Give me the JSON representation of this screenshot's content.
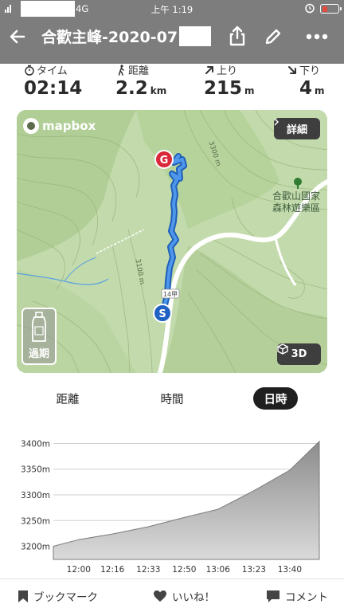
{
  "status": {
    "network": "4G",
    "time": "上午 1:19"
  },
  "header": {
    "title": "合歡主峰-2020-07"
  },
  "stats": [
    {
      "label": "タイム",
      "icon": "stopwatch-icon",
      "value": "02:14",
      "unit": ""
    },
    {
      "label": "距離",
      "icon": "hiker-icon",
      "value": "2.2",
      "unit": "km"
    },
    {
      "label": "上り",
      "icon": "arrow-up-right-icon",
      "value": "215",
      "unit": "m"
    },
    {
      "label": "下り",
      "icon": "arrow-down-right-icon",
      "value": "4",
      "unit": "m"
    }
  ],
  "map": {
    "logo": "mapbox",
    "detail_button": "詳細",
    "three_d_button": "3D",
    "expired_badge": "過期",
    "poi_label": "合歡山國家森林遊樂區",
    "contour_labels": [
      "3300 m",
      "3100 m"
    ],
    "road_label": "14甲",
    "start_marker": "S",
    "goal_marker": "G",
    "colors": {
      "route": "#2f7bd9",
      "goal": "#d9283a",
      "start": "#1f62c4",
      "terrain": "#bfd8a8"
    }
  },
  "toggle": {
    "options": [
      "距離",
      "時間",
      "日時"
    ],
    "selected": "日時"
  },
  "chart_data": {
    "type": "area",
    "x": [
      "11:48",
      "12:00",
      "12:16",
      "12:33",
      "12:50",
      "13:06",
      "13:23",
      "13:40",
      "13:54"
    ],
    "series": [
      {
        "values": [
          3200,
          3213,
          3224,
          3238,
          3256,
          3272,
          3308,
          3348,
          3404
        ]
      }
    ],
    "xticks": [
      "12:00",
      "12:16",
      "12:33",
      "12:50",
      "13:06",
      "13:23",
      "13:40"
    ],
    "yticks": [
      "3400m",
      "3350m",
      "3300m",
      "3250m",
      "3200m"
    ],
    "ylim": [
      3190,
      3410
    ],
    "grid": true
  },
  "bottom_bar": {
    "bookmark": "ブックマーク",
    "like": "いいね！",
    "comment": "コメント"
  }
}
